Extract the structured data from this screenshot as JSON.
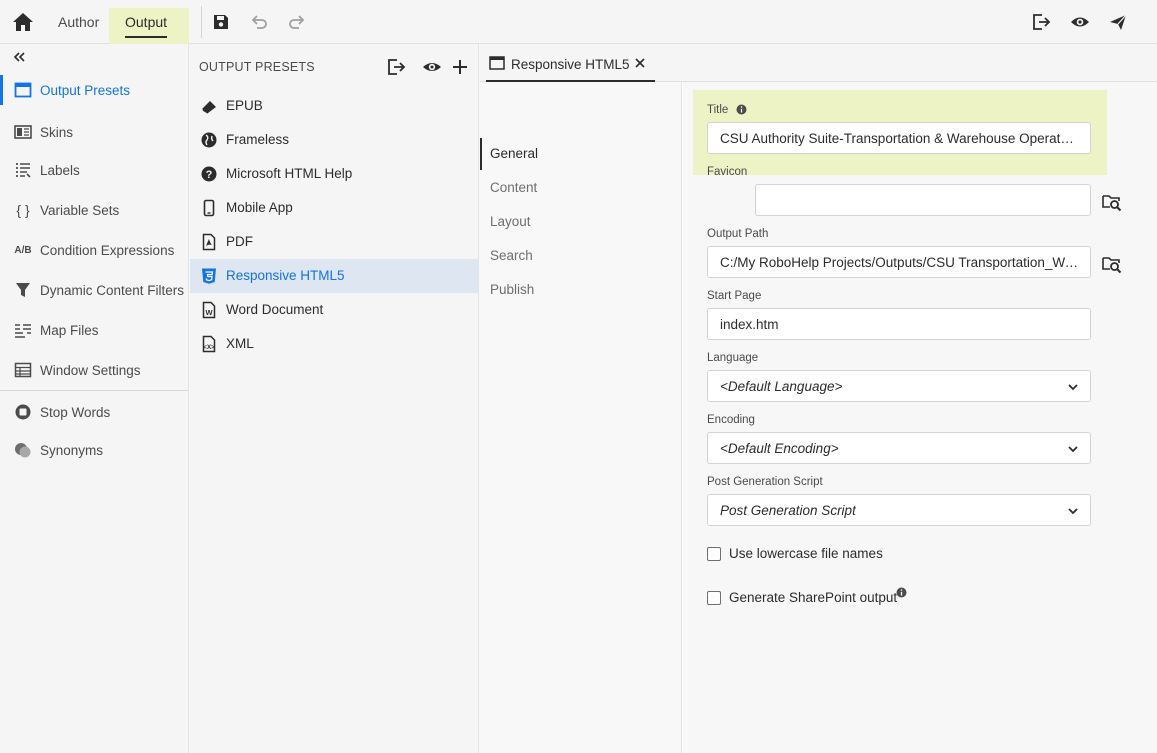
{
  "topbar": {
    "tabs": [
      "Author",
      "Output"
    ],
    "active_tab": "Output",
    "icons": [
      "home-icon",
      "save-icon",
      "undo-icon",
      "redo-icon",
      "generate-icon",
      "preview-icon",
      "publish-icon"
    ]
  },
  "leftnav": {
    "items": [
      {
        "label": "Output Presets",
        "icon": "output-presets-icon",
        "active": true
      },
      {
        "label": "Skins",
        "icon": "skins-icon"
      },
      {
        "label": "Labels",
        "icon": "labels-icon"
      },
      {
        "label": "Variable Sets",
        "icon": "variable-sets-icon",
        "glyph": "{ }"
      },
      {
        "label": "Condition Expressions",
        "icon": "condition-expressions-icon",
        "glyph": "A/B"
      },
      {
        "label": "Dynamic Content Filters",
        "icon": "filter-icon"
      },
      {
        "label": "Map Files",
        "icon": "map-files-icon"
      },
      {
        "label": "Window Settings",
        "icon": "window-settings-icon"
      },
      {
        "label": "Stop Words",
        "icon": "stop-words-icon"
      },
      {
        "label": "Synonyms",
        "icon": "synonyms-icon"
      }
    ]
  },
  "presets": {
    "title": "OUTPUT PRESETS",
    "items": [
      {
        "label": "EPUB",
        "icon": "epub-icon"
      },
      {
        "label": "Frameless",
        "icon": "globe-icon"
      },
      {
        "label": "Microsoft HTML Help",
        "icon": "help-icon"
      },
      {
        "label": "Mobile App",
        "icon": "mobile-icon"
      },
      {
        "label": "PDF",
        "icon": "pdf-icon"
      },
      {
        "label": "Responsive HTML5",
        "icon": "html5-icon",
        "selected": true
      },
      {
        "label": "Word Document",
        "icon": "word-icon"
      },
      {
        "label": "XML",
        "icon": "xml-icon"
      }
    ]
  },
  "editor": {
    "tab_label": "Responsive HTML5",
    "sections": [
      "General",
      "Content",
      "Layout",
      "Search",
      "Publish"
    ],
    "active_section": "General",
    "form": {
      "title_label": "Title",
      "title_value": "CSU Authority Suite-Transportation & Warehouse Operators ...",
      "favicon_label": "Favicon",
      "favicon_value": "",
      "output_path_label": "Output Path",
      "output_path_value": "C:/My RoboHelp Projects/Outputs/CSU Transportation_Ware...",
      "start_page_label": "Start Page",
      "start_page_value": "index.htm",
      "language_label": "Language",
      "language_value": "<Default Language>",
      "encoding_label": "Encoding",
      "encoding_value": "<Default Encoding>",
      "post_gen_label": "Post Generation Script",
      "post_gen_value": "Post Generation Script",
      "lowercase_label": "Use lowercase file names",
      "lowercase_checked": false,
      "sharepoint_label": "Generate SharePoint output",
      "sharepoint_checked": false
    }
  },
  "colors": {
    "accent": "#1473e6",
    "highlight": "#eef3c6",
    "selected_row": "#dde6f1"
  }
}
